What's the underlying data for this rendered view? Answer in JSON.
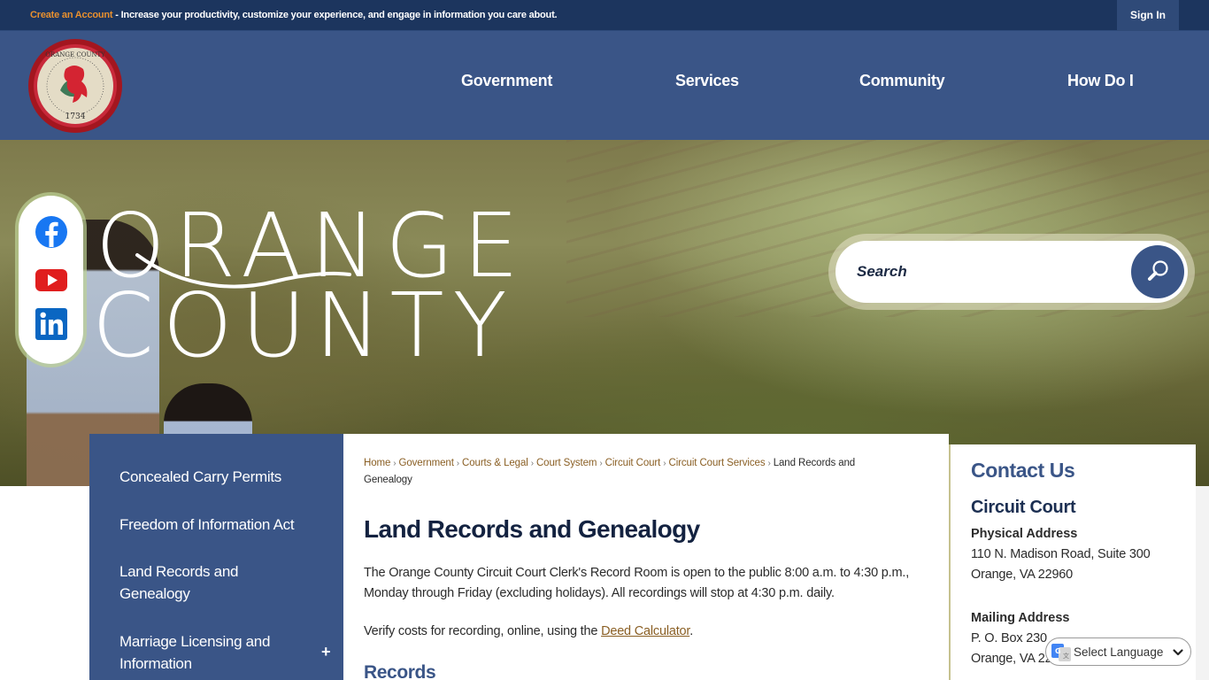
{
  "topbar": {
    "create_account_link": "Create an Account",
    "promo_text": " - Increase your productivity, customize your experience, and engage in information you care about.",
    "sign_in": "Sign In"
  },
  "header": {
    "seal_alt": "Orange County Virginia seal 1734",
    "nav": [
      "Government",
      "Services",
      "Community",
      "How Do I"
    ]
  },
  "hero": {
    "logo_line1": "ORANGE",
    "logo_line2": "COUNTY",
    "social": [
      "facebook-icon",
      "youtube-icon",
      "linkedin-icon"
    ],
    "search_placeholder": "Search"
  },
  "subnav": {
    "items": [
      "Concealed Carry Permits",
      "Freedom of Information Act",
      "Land Records and Genealogy",
      "Marriage Licensing and Information"
    ],
    "expand_symbol": "+"
  },
  "breadcrumb": {
    "links": [
      "Home",
      "Government",
      "Courts & Legal",
      "Court System",
      "Circuit Court",
      "Circuit Court Services"
    ],
    "current": "Land Records and Genealogy",
    "separator": "›"
  },
  "main": {
    "title": "Land Records and Genealogy",
    "para1": "The Orange County Circuit Court Clerk's Record Room is open to the public 8:00 a.m. to 4:30 p.m., Monday through Friday (excluding holidays). All recordings will stop at 4:30 p.m. daily.",
    "para2_before": "Verify costs for recording, online, using the ",
    "para2_link": "Deed Calculator",
    "para2_after": ".",
    "section_heading": "Records"
  },
  "contact": {
    "heading": "Contact Us",
    "department": "Circuit Court",
    "physical_label": "Physical Address",
    "physical_line1": "110 N. Madison Road, Suite 300",
    "physical_line2": "Orange, VA 22960",
    "mailing_label": "Mailing Address",
    "mailing_line1": "P. O. Box 230",
    "mailing_line2": "Orange, VA 22960"
  },
  "translate": {
    "label": "Select Language"
  },
  "colors": {
    "topbar": "#1c355e",
    "header": "#3a5587",
    "accent_orange": "#e8902e",
    "link_brown": "#8a5f24",
    "title_navy": "#132240"
  }
}
